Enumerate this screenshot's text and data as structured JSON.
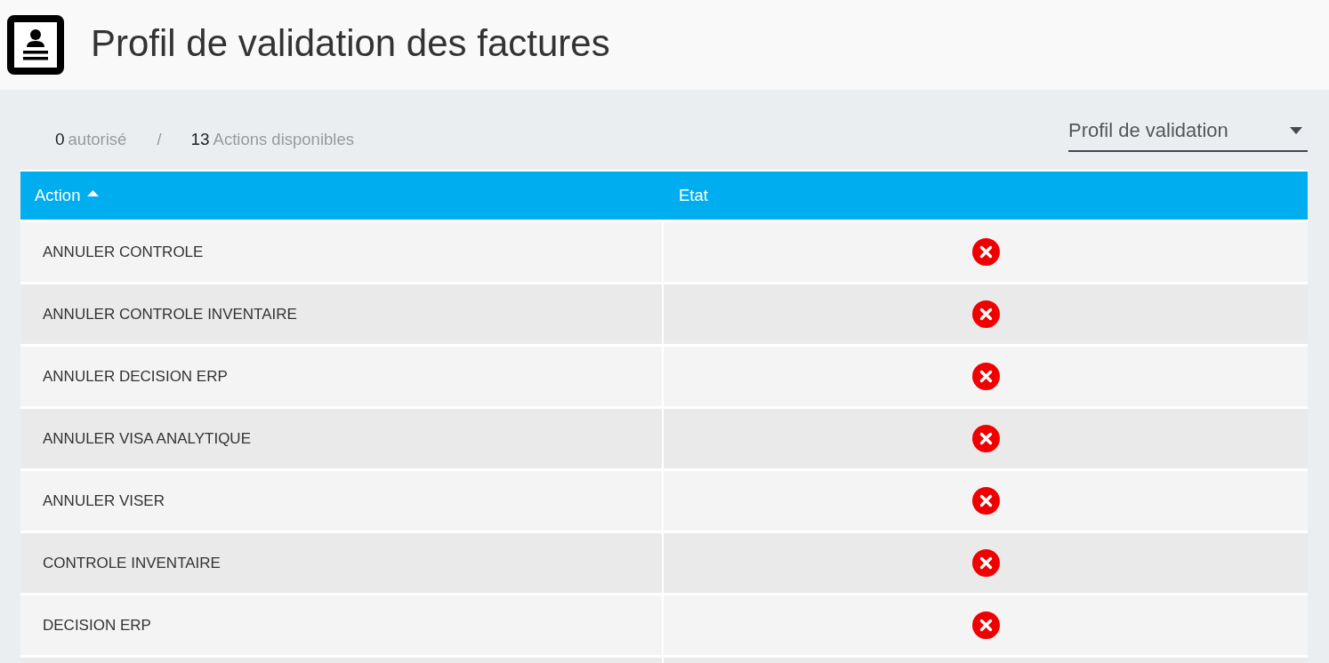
{
  "header": {
    "title": "Profil de validation des factures"
  },
  "summary": {
    "authorized_count": "0",
    "authorized_label": "autorisé",
    "separator": "/",
    "available_count": "13",
    "available_label": "Actions disponibles"
  },
  "profile_select": {
    "placeholder": "Profil de validation"
  },
  "table": {
    "columns": [
      {
        "label": "Action",
        "sorted_ascending": true
      },
      {
        "label": "Etat"
      }
    ],
    "rows": [
      {
        "action": "ANNULER CONTROLE",
        "authorized": false
      },
      {
        "action": "ANNULER CONTROLE INVENTAIRE",
        "authorized": false
      },
      {
        "action": "ANNULER DECISION ERP",
        "authorized": false
      },
      {
        "action": "ANNULER VISA ANALYTIQUE",
        "authorized": false
      },
      {
        "action": "ANNULER VISER",
        "authorized": false
      },
      {
        "action": "CONTROLE INVENTAIRE",
        "authorized": false
      },
      {
        "action": "DECISION ERP",
        "authorized": false
      }
    ]
  }
}
